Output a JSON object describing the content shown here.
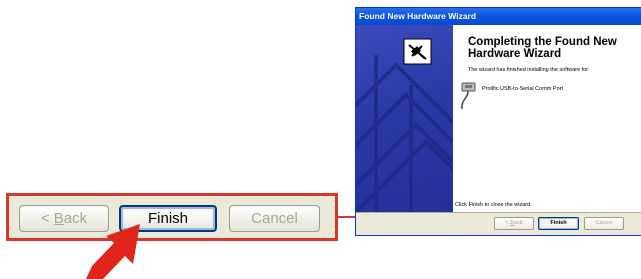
{
  "zoom": {
    "back_label_pre": "< ",
    "back_label_key": "B",
    "back_label_post": "ack",
    "finish_label": "Finish",
    "cancel_label": "Cancel"
  },
  "wizard": {
    "title": "Found New Hardware Wizard",
    "heading": "Completing the Found New Hardware Wizard",
    "intro": "The wizard has finished installing the software for:",
    "device_name": "Prolific USB-to-Serial Comm Port",
    "close_hint": "Click Finish to close the wizard.",
    "buttons": {
      "back_pre": "< ",
      "back_key": "B",
      "back_post": "ack",
      "finish": "Finish",
      "cancel": "Cancel"
    }
  },
  "colors": {
    "highlight": "#d8372b",
    "titlebar": "#0856e0",
    "sidebar": "#2b3aa6"
  },
  "icons": [
    "hardware-wizard-icon",
    "serial-port-icon",
    "red-pointer-arrow",
    "connector-arrow"
  ]
}
